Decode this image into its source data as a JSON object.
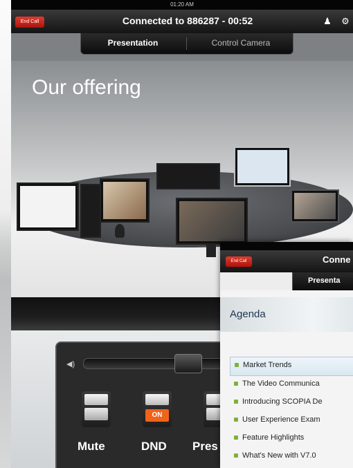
{
  "status_bar": {
    "time": "01:20 AM"
  },
  "header": {
    "end_call_label": "End Call",
    "title": "Connected to 886287 - 00:52",
    "icons": [
      "person-icon",
      "gear-icon"
    ]
  },
  "tabs": [
    {
      "label": "Presentation",
      "active": true
    },
    {
      "label": "Control Camera",
      "active": false
    }
  ],
  "slide": {
    "title": "Our offering"
  },
  "controls": {
    "volume_icon": "speaker-icon",
    "volume_level": 0.68,
    "buttons": [
      {
        "label": "Mute",
        "on": false,
        "badge": ""
      },
      {
        "label": "DND",
        "on": true,
        "badge": "ON"
      },
      {
        "label": "Pres",
        "on": false,
        "badge": ""
      }
    ]
  },
  "overlay": {
    "end_call_label": "End Call",
    "title": "Conne",
    "tab_label": "Presenta",
    "agenda_title": "Agenda",
    "agenda_items": [
      {
        "label": "Market Trends",
        "selected": true
      },
      {
        "label": "The Video Communica",
        "selected": false
      },
      {
        "label": "Introducing SCOPIA De",
        "selected": false
      },
      {
        "label": "User Experience Exam",
        "selected": false
      },
      {
        "label": "Feature Highlights",
        "selected": false
      },
      {
        "label": "What's New with V7.0",
        "selected": false
      }
    ]
  },
  "colors": {
    "end_call": "#c8241a",
    "on_badge": "#f0631a",
    "agenda_bullet": "#7fb13a"
  }
}
